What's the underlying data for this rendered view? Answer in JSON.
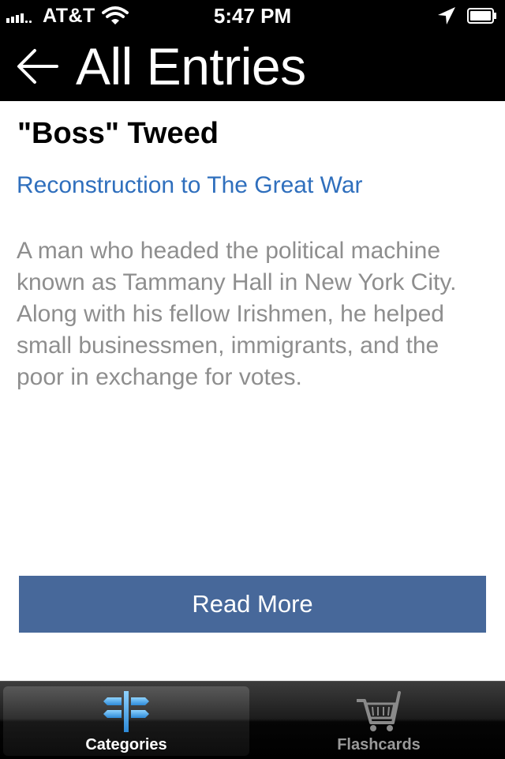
{
  "status_bar": {
    "carrier": "AT&T",
    "time": "5:47 PM",
    "icons": [
      "signal-icon",
      "wifi-icon",
      "location-arrow-icon",
      "battery-icon"
    ]
  },
  "header": {
    "back_icon": "back-arrow-icon",
    "title": "All Entries"
  },
  "entry": {
    "title": "\"Boss\" Tweed",
    "category": "Reconstruction to The Great War",
    "description": "A man who headed the political machine known as Tammany Hall in New York City. Along with his fellow Irishmen, he helped small businessmen, immigrants, and the poor in exchange for votes.",
    "read_more_label": "Read More"
  },
  "tab_bar": {
    "tabs": [
      {
        "label": "Categories",
        "icon": "signpost-icon",
        "selected": true
      },
      {
        "label": "Flashcards",
        "icon": "shopping-cart-icon",
        "selected": false
      }
    ]
  },
  "colors": {
    "header_bg": "#000000",
    "category_link": "#2f6fbd",
    "description_text": "#8e8e8e",
    "button_bg": "#47689a",
    "tab_selected_icon": "#3a9ee8"
  }
}
